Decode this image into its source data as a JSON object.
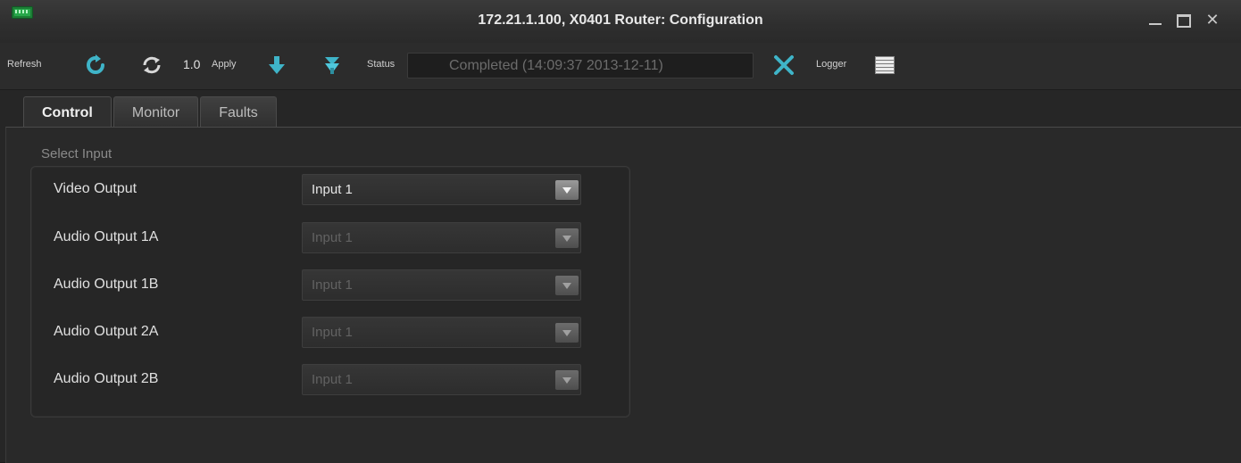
{
  "window": {
    "title": "172.21.1.100, X0401 Router: Configuration"
  },
  "toolbar": {
    "refresh_label": "Refresh",
    "apply_value": "1.0",
    "apply_label": "Apply",
    "status_label": "Status",
    "status_value": "Completed  (14:09:37  2013-12-11)",
    "logger_label": "Logger"
  },
  "tabs": [
    {
      "label": "Control",
      "active": true
    },
    {
      "label": "Monitor",
      "active": false
    },
    {
      "label": "Faults",
      "active": false
    }
  ],
  "control": {
    "group_title": "Select Input",
    "rows": [
      {
        "label": "Video Output",
        "value": "Input 1",
        "enabled": true
      },
      {
        "label": "Audio Output 1A",
        "value": "Input 1",
        "enabled": false
      },
      {
        "label": "Audio Output 1B",
        "value": "Input 1",
        "enabled": false
      },
      {
        "label": "Audio Output 2A",
        "value": "Input 1",
        "enabled": false
      },
      {
        "label": "Audio Output 2B",
        "value": "Input 1",
        "enabled": false
      }
    ]
  },
  "colors": {
    "icon_accent": "#3fb4c8",
    "app_icon": "#27a84a"
  },
  "icons": {
    "refresh": "refresh-icon",
    "sync": "sync-icon",
    "download": "download-arrow-icon",
    "download_all": "download-all-icon",
    "cancel": "cancel-x-icon",
    "logger": "logger-list-icon"
  }
}
